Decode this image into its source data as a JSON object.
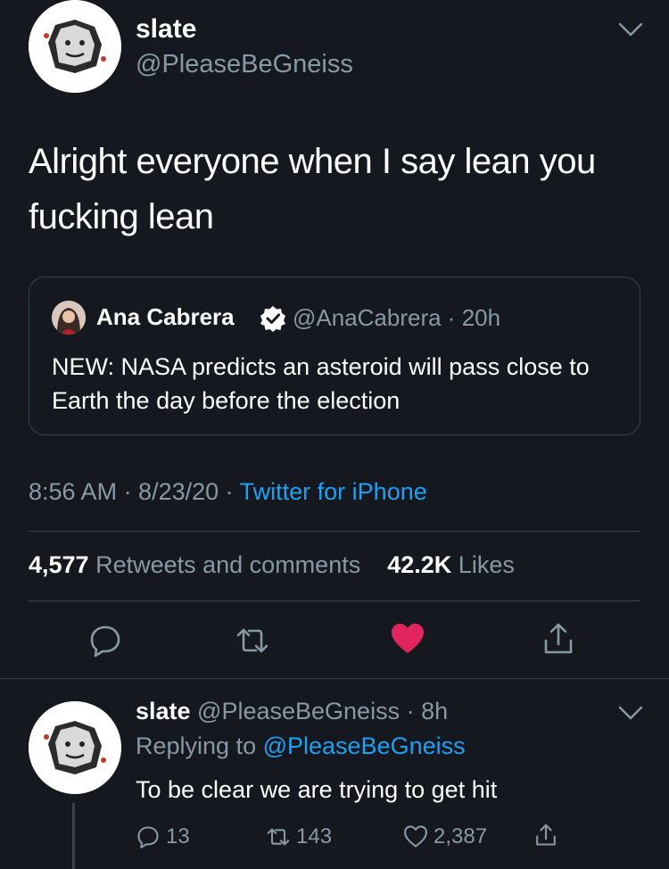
{
  "colors": {
    "background": "#15181f",
    "text": "#ffffff",
    "muted": "#8899a6",
    "link": "#1da1f2",
    "like": "#e0245e",
    "border": "#38444d"
  },
  "tweet": {
    "author_name": "slate",
    "author_handle": "@PleaseBeGneiss",
    "text": "Alright everyone when I say lean you fucking lean",
    "avatar_icon": "rock-cartoon-avatar",
    "menu_icon": "chevron-down-icon"
  },
  "quote": {
    "author_name": "Ana Cabrera",
    "verified_icon": "verified-badge-icon",
    "meta": "@AnaCabrera · 20h",
    "text": "NEW: NASA predicts an asteroid will pass close to Earth the day before the election"
  },
  "timestamp": {
    "time_date": "8:56 AM · 8/23/20 · ",
    "source": "Twitter for iPhone"
  },
  "stats": {
    "retweets_count": "4,577",
    "retweets_label": " Retweets and comments",
    "likes_count": "42.2K",
    "likes_label": " Likes"
  },
  "actions": {
    "reply_icon": "comment-icon",
    "retweet_icon": "retweet-icon",
    "like_icon": "heart-filled-icon",
    "share_icon": "share-icon",
    "liked": true
  },
  "reply": {
    "author_name": "slate",
    "meta": " @PleaseBeGneiss · 8h",
    "replying_to_label": "Replying to ",
    "replying_to_handle": "@PleaseBeGneiss",
    "text": "To be clear we are trying to get hit",
    "reply_count": "13",
    "retweet_count": "143",
    "like_count": "2,387"
  }
}
